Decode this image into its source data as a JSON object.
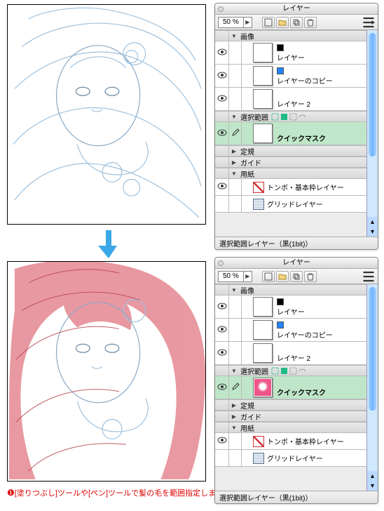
{
  "panel_title": "レイヤー",
  "opacity": "50 %",
  "status_text": "選択範囲レイヤー（黒(1bit)）",
  "groups": {
    "image": "画像",
    "selection": "選択範囲",
    "ruler": "定規",
    "guide": "ガイド",
    "paper": "用紙"
  },
  "layers": {
    "layer": "レイヤー",
    "layer_copy": "レイヤーのコピー",
    "layer2": "レイヤー 2",
    "quickmask": "クイックマスク",
    "tombo": "トンボ・基本枠レイヤー",
    "grid": "グリッドレイヤー"
  },
  "caption": {
    "bullet": "❶",
    "text": "[塗りつぶし]ツールや[ペン]ツールで髪の毛を範囲指定しました。"
  }
}
